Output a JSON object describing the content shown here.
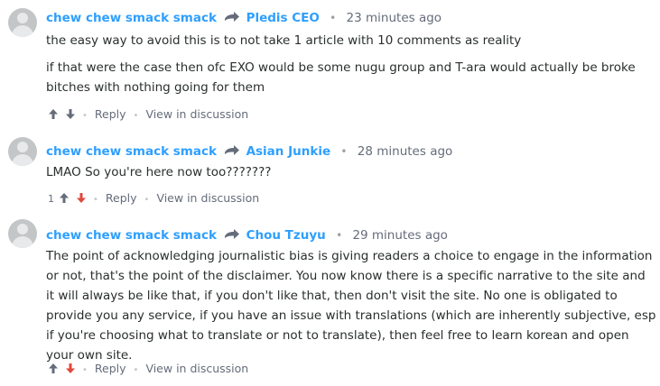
{
  "comments": [
    {
      "author": "chew chew smack smack",
      "reply_to": "Pledis CEO",
      "time": "23 minutes ago",
      "paragraphs": [
        "the easy way to avoid this is to not take 1 article with 10 comments as reality",
        "if that were the case then ofc EXO would be some nugu group and T-ara would actually be broke bitches with nothing going for them"
      ],
      "vote_count": "",
      "reply_label": "Reply",
      "view_label": "View in discussion"
    },
    {
      "author": "chew chew smack smack",
      "reply_to": "Asian Junkie",
      "time": "28 minutes ago",
      "paragraphs": [
        "LMAO So you're here now too???????"
      ],
      "vote_count": "1",
      "reply_label": "Reply",
      "view_label": "View in discussion"
    },
    {
      "author": "chew chew smack smack",
      "reply_to": "Chou Tzuyu",
      "time": "29 minutes ago",
      "paragraphs": [
        "The point of acknowledging journalistic bias is giving readers a choice to engage in the information or not, that's the point of the disclaimer. You now know there is a specific narrative to the site and it will always be like that, if you don't like that, then don't visit the site. No one is obligated to provide you any service, if you have an issue with translations (which are inherently subjective, esp if you're choosing what to translate or not to translate), then feel free to learn korean and open your own site."
      ],
      "vote_count": "",
      "reply_label": "Reply",
      "view_label": "View in discussion"
    }
  ],
  "colors": {
    "link": "#2e9fff",
    "muted": "#656c7a",
    "downvote_active": "#e0483e",
    "text": "#2a2e2e"
  },
  "icons": {
    "reply_to": "reply-arrow-icon",
    "upvote": "upvote-arrow-icon",
    "downvote": "downvote-arrow-icon",
    "avatar": "default-avatar-icon"
  }
}
